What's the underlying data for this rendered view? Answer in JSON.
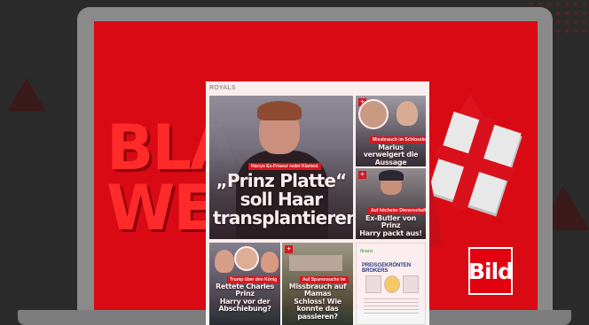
{
  "background": {
    "black_friday_line1": "BLA",
    "black_friday_line2": "WE",
    "accent_color": "#d90a14"
  },
  "brand": {
    "logo_text": "Bild"
  },
  "royals_panel": {
    "section_title": "ROYALS",
    "hero": {
      "kicker": "Harrys Ex-Friseur redet Klartext",
      "headline_line1": "„Prinz Platte“",
      "headline_line2": "soll Haar",
      "headline_line3": "transplantieren"
    },
    "marius": {
      "kicker": "Missbrauch im Schlosskeller",
      "headline_line1": "Marius verweigert die",
      "headline_line2": "Aussage"
    },
    "butler": {
      "kicker": "Auf höchster Dienerschaft",
      "headline_line1": "Ex-Butler von Prinz",
      "headline_line2": "Harry packt aus!"
    },
    "charles": {
      "kicker": "Trump über den König",
      "headline_line1": "Rettete Charles Prinz",
      "headline_line2": "Harry vor der",
      "headline_line3": "Abschiebung?"
    },
    "schloss": {
      "kicker": "Auf Spurensuche im",
      "headline_line1": "Missbrauch auf Mamas",
      "headline_line2": "Schloss! Wie konnte das",
      "headline_line3": "passieren?"
    },
    "ad": {
      "top_text": "finanz",
      "title": "PREISGEKRÖNTEN BROKERS"
    }
  }
}
